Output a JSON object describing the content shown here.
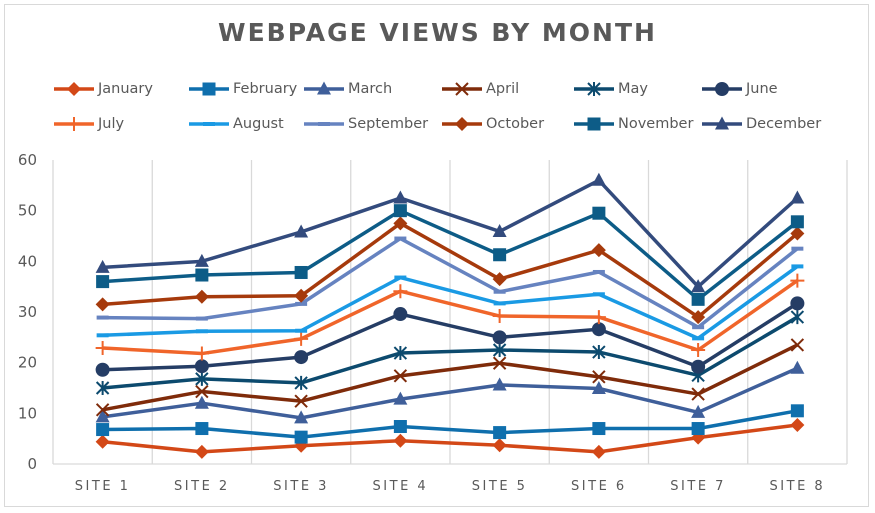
{
  "chart_data": {
    "type": "line",
    "title": "WEBPAGE VIEWS BY MONTH",
    "xlabel": "",
    "ylabel": "",
    "ylim": [
      0,
      60
    ],
    "yticks": [
      0,
      10,
      20,
      30,
      40,
      50,
      60
    ],
    "grid": "vertical",
    "legend_position": "top",
    "categories": [
      "SITE 1",
      "SITE 2",
      "SITE 3",
      "SITE 4",
      "SITE 5",
      "SITE 6",
      "SITE 7",
      "SITE 8"
    ],
    "series": [
      {
        "name": "January",
        "color": "#d34817",
        "marker": "diamond",
        "values": [
          4.4,
          2.4,
          3.6,
          4.6,
          3.7,
          2.4,
          5.2,
          7.7
        ]
      },
      {
        "name": "February",
        "color": "#0f6fad",
        "marker": "square",
        "values": [
          6.8,
          7.0,
          5.3,
          7.4,
          6.2,
          7.0,
          7.0,
          10.5
        ]
      },
      {
        "name": "March",
        "color": "#3f5f9a",
        "marker": "triangle",
        "values": [
          9.3,
          12.0,
          9.1,
          12.8,
          15.6,
          14.9,
          10.2,
          18.9
        ]
      },
      {
        "name": "April",
        "color": "#7f2b0a",
        "marker": "x",
        "values": [
          10.7,
          14.3,
          12.4,
          17.4,
          19.9,
          17.2,
          13.8,
          23.5
        ]
      },
      {
        "name": "May",
        "color": "#0c4a6e",
        "marker": "star",
        "values": [
          15.0,
          16.8,
          16.0,
          21.9,
          22.5,
          22.1,
          17.5,
          29.0
        ]
      },
      {
        "name": "June",
        "color": "#253d65",
        "marker": "circle",
        "values": [
          18.6,
          19.3,
          21.1,
          29.6,
          25.0,
          26.6,
          19.2,
          31.7
        ]
      },
      {
        "name": "July",
        "color": "#f0652a",
        "marker": "plus",
        "values": [
          22.9,
          21.8,
          24.7,
          34.1,
          29.2,
          29.0,
          22.5,
          36.2
        ]
      },
      {
        "name": "August",
        "color": "#1a9ae4",
        "marker": "dash",
        "values": [
          25.4,
          26.2,
          26.3,
          36.8,
          31.7,
          33.5,
          24.8,
          39.0
        ]
      },
      {
        "name": "September",
        "color": "#6683c0",
        "marker": "dash",
        "values": [
          28.9,
          28.7,
          31.6,
          44.5,
          34.0,
          37.9,
          27.0,
          42.5
        ]
      },
      {
        "name": "October",
        "color": "#a63a0c",
        "marker": "diamond",
        "values": [
          31.5,
          33.0,
          33.2,
          47.5,
          36.5,
          42.2,
          29.0,
          45.5
        ]
      },
      {
        "name": "November",
        "color": "#0d5c87",
        "marker": "square",
        "values": [
          36.0,
          37.3,
          37.8,
          50.0,
          41.3,
          49.5,
          32.5,
          47.8
        ]
      },
      {
        "name": "December",
        "color": "#334b7d",
        "marker": "triangle",
        "values": [
          38.8,
          40.0,
          45.8,
          52.5,
          45.9,
          56.0,
          35.0,
          52.5
        ]
      }
    ]
  }
}
